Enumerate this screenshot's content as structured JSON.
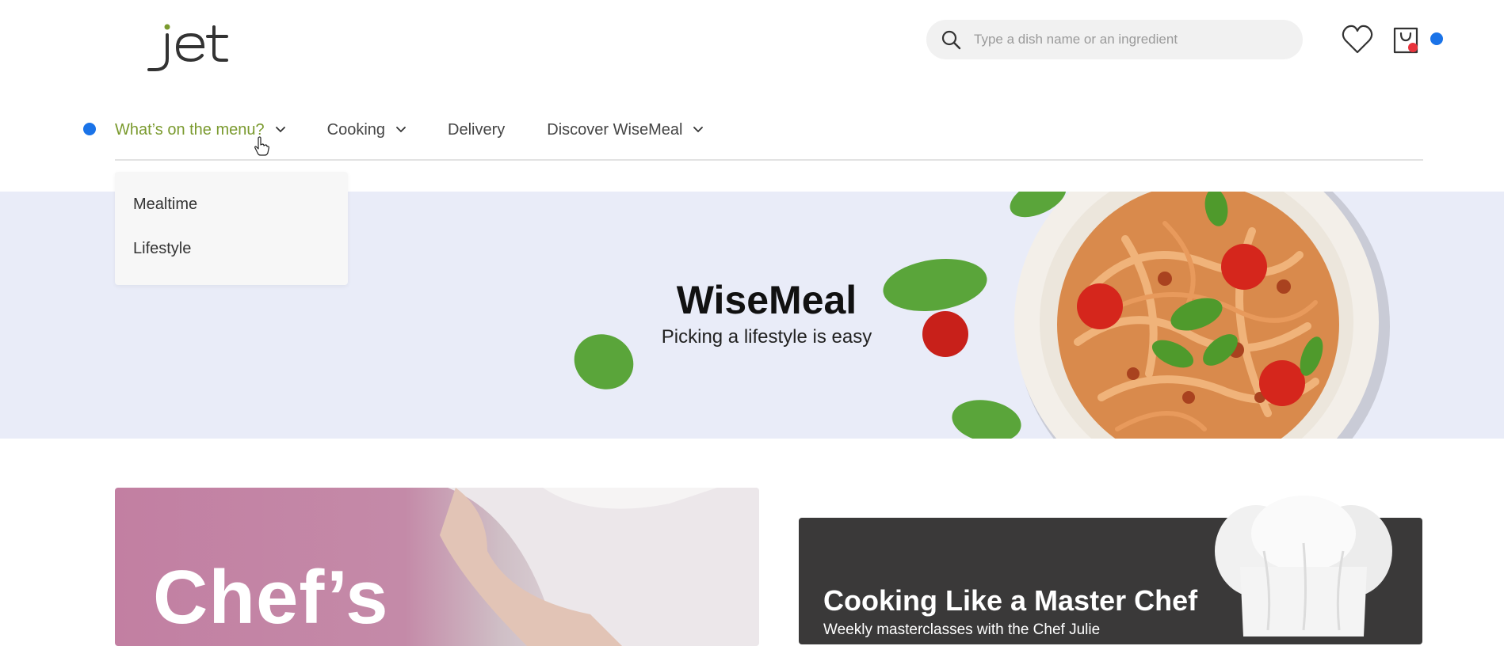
{
  "header": {
    "logo_text": "jet",
    "search": {
      "placeholder": "Type a dish name or an ingredient",
      "value": ""
    },
    "icons": [
      "search-icon",
      "heart-icon",
      "shopping-bag-icon"
    ]
  },
  "nav": {
    "items": [
      {
        "label": "What’s on the menu?",
        "has_dropdown": true,
        "active": true
      },
      {
        "label": "Cooking",
        "has_dropdown": true,
        "active": false
      },
      {
        "label": "Delivery",
        "has_dropdown": false,
        "active": false
      },
      {
        "label": "Discover WiseMeal",
        "has_dropdown": true,
        "active": false
      }
    ]
  },
  "dropdown": {
    "items": [
      {
        "label": "Mealtime"
      },
      {
        "label": "Lifestyle"
      }
    ]
  },
  "hero": {
    "title": "WiseMeal",
    "subtitle": "Picking a lifestyle is easy"
  },
  "cards": {
    "left": {
      "text": "Chef’s"
    },
    "right": {
      "title": "Cooking Like a Master Chef",
      "subtitle": "Weekly masterclasses with the Chef Julie"
    }
  },
  "colors": {
    "accent": "#7a9a2e",
    "hero_bg": "#e9ecf8",
    "card_dark": "#3a3939",
    "badge_red": "#e8333c",
    "marker_blue": "#1a73e8"
  }
}
